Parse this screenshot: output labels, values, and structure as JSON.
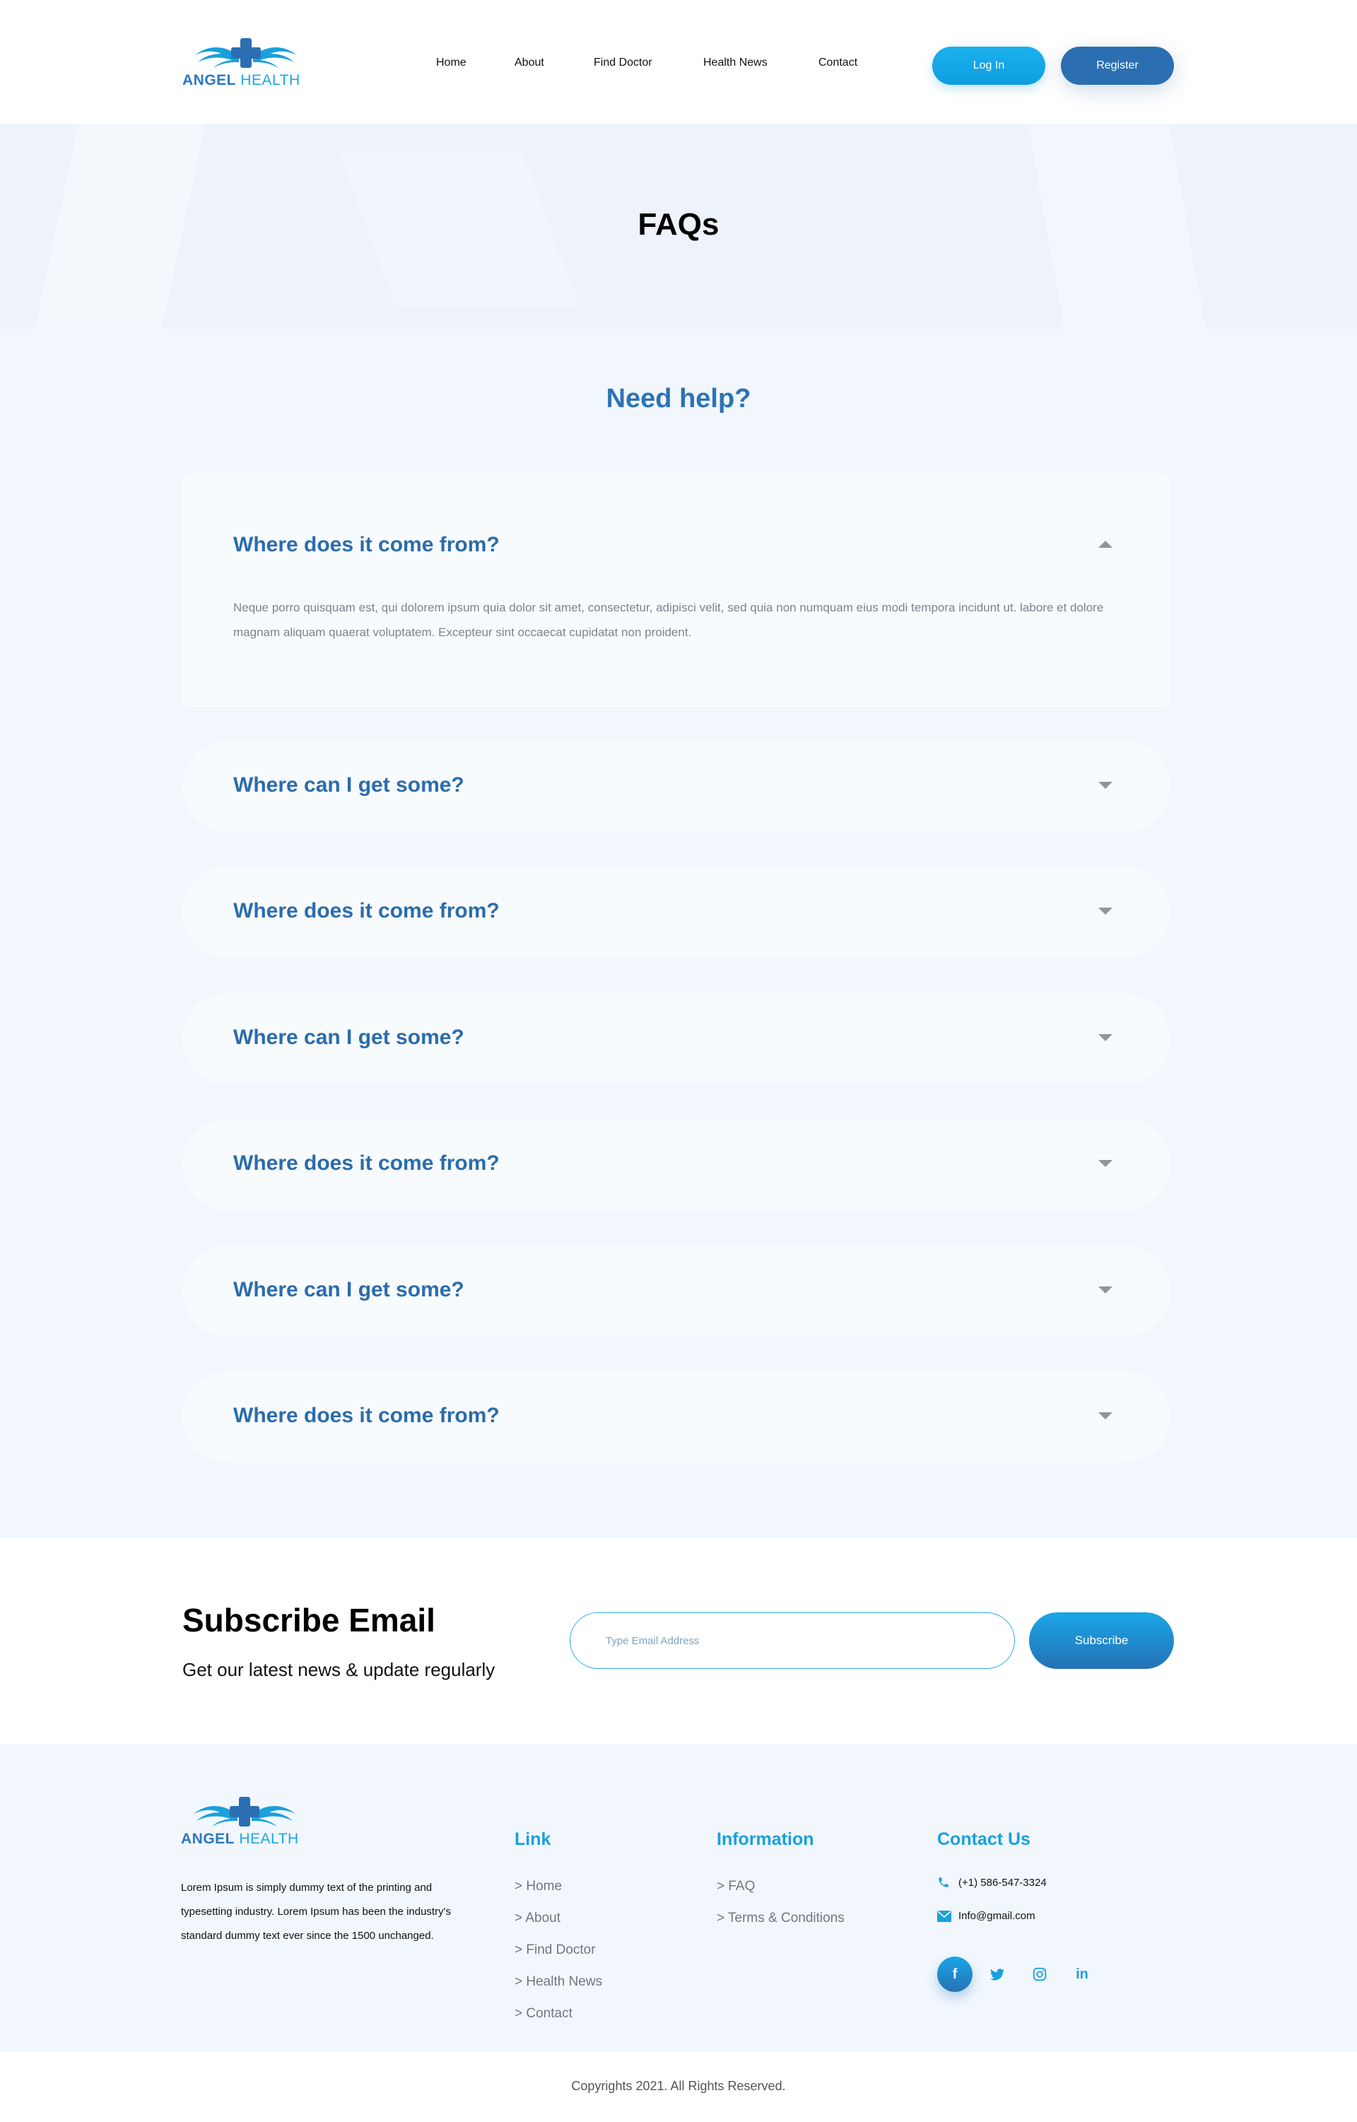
{
  "brand": {
    "name_bold": "ANGEL",
    "name_light": "HEALTH"
  },
  "nav": {
    "items": [
      "Home",
      "About",
      "Find Doctor",
      "Health News",
      "Contact"
    ]
  },
  "auth": {
    "login": "Log In",
    "register": "Register"
  },
  "hero": {
    "title": "FAQs"
  },
  "faq": {
    "heading": "Need help?",
    "items": [
      {
        "question": "Where does it come from?",
        "answer": "Neque porro quisquam est, qui dolorem ipsum quia dolor sit amet, consectetur, adipisci velit, sed quia non numquam eius modi tempora incidunt ut. labore et dolore magnam aliquam quaerat voluptatem. Excepteur sint occaecat cupidatat non proident.",
        "expanded": true
      },
      {
        "question": "Where can I get some?",
        "expanded": false
      },
      {
        "question": "Where does it come from?",
        "expanded": false
      },
      {
        "question": "Where can I get some?",
        "expanded": false
      },
      {
        "question": "Where does it come from?",
        "expanded": false
      },
      {
        "question": "Where can I get some?",
        "expanded": false
      },
      {
        "question": "Where does it come from?",
        "expanded": false
      }
    ]
  },
  "subscribe": {
    "title": "Subscribe Email",
    "subtitle": "Get our latest news & update regularly",
    "placeholder": "Type Email Address",
    "button": "Subscribe"
  },
  "footer": {
    "about": "Lorem Ipsum is simply dummy text of the printing and typesetting industry. Lorem Ipsum has been the industry's standard dummy text ever since the 1500 unchanged.",
    "link_title": "Link",
    "links": [
      "> Home",
      "> About",
      "> Find Doctor",
      "> Health News",
      "> Contact"
    ],
    "info_title": "Information",
    "info_links": [
      "> FAQ",
      "> Terms & Conditions"
    ],
    "contact_title": "Contact Us",
    "phone": "(+1) 586-547-3324",
    "email": "Info@gmail.com",
    "socials": [
      "facebook-icon",
      "twitter-icon",
      "instagram-icon",
      "linkedin-icon"
    ]
  },
  "copyright": "Copyrights 2021. All Rights Reserved.",
  "colors": {
    "primary": "#2b6fb2",
    "accent": "#1aa0dc",
    "faq_text": "#2b6cab",
    "section_bg": "#f1f7fd"
  }
}
